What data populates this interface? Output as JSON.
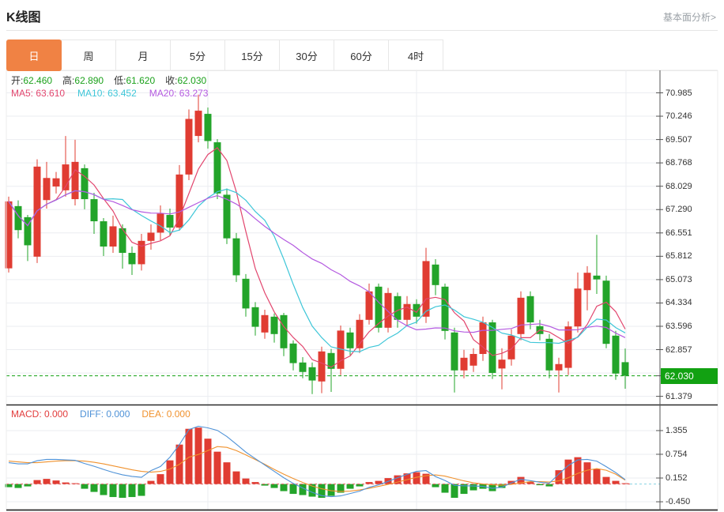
{
  "header": {
    "title": "K线图",
    "link": "基本面分析>"
  },
  "tabs": {
    "active_index": 0,
    "items": [
      "日",
      "周",
      "月",
      "5分",
      "15分",
      "30分",
      "60分",
      "4时"
    ]
  },
  "info_bar": {
    "items": [
      {
        "label": "开:",
        "value": "62.460"
      },
      {
        "label": "高:",
        "value": "62.890"
      },
      {
        "label": "低:",
        "value": "61.620"
      },
      {
        "label": "收:",
        "value": "62.030"
      }
    ],
    "value_color": "#1ba11b"
  },
  "ma_bar": {
    "items": [
      {
        "label": "MA5:",
        "value": "63.610",
        "color": "#e2466e"
      },
      {
        "label": "MA10:",
        "value": "63.452",
        "color": "#3ec6d8"
      },
      {
        "label": "MA20:",
        "value": "63.273",
        "color": "#b45ae0"
      }
    ]
  },
  "macd_bar": {
    "items": [
      {
        "label": "MACD:",
        "value": "0.000",
        "color": "#e23b3b"
      },
      {
        "label": "DIFF:",
        "value": "0.000",
        "color": "#4f92d7"
      },
      {
        "label": "DEA:",
        "value": "0.000",
        "color": "#f0922e"
      }
    ]
  },
  "price_axis": {
    "ticks": [
      {
        "label": "70.985",
        "value": 70.985
      },
      {
        "label": "70.246",
        "value": 70.246
      },
      {
        "label": "69.507",
        "value": 69.507
      },
      {
        "label": "68.768",
        "value": 68.768
      },
      {
        "label": "68.029",
        "value": 68.029
      },
      {
        "label": "67.290",
        "value": 67.29
      },
      {
        "label": "66.551",
        "value": 66.551
      },
      {
        "label": "65.812",
        "value": 65.812
      },
      {
        "label": "65.073",
        "value": 65.073
      },
      {
        "label": "64.334",
        "value": 64.334
      },
      {
        "label": "63.596",
        "value": 63.596
      },
      {
        "label": "62.857",
        "value": 62.857
      },
      {
        "label": "61.379",
        "value": 61.379
      }
    ],
    "current_price_label": "62.030",
    "current_price": 62.03
  },
  "macd_axis": {
    "ticks": [
      {
        "label": "1.355",
        "value": 1.355
      },
      {
        "label": "0.754",
        "value": 0.754
      },
      {
        "label": "0.152",
        "value": 0.152
      },
      {
        "label": "-0.450",
        "value": -0.45
      }
    ]
  },
  "chart_data": {
    "type": "candlestick",
    "title": "K线图",
    "legend": [
      "MA5",
      "MA10",
      "MA20",
      "MACD",
      "DIFF",
      "DEA"
    ],
    "ylim_price": [
      61.2,
      71.0
    ],
    "ylim_macd": [
      -0.75,
      1.66
    ],
    "grid": true,
    "colors": {
      "up": "#e03c32",
      "down": "#23a42a",
      "badge": "#12a112",
      "grid": "#ebedf1",
      "axis": "#555555",
      "dashed_price": "#12a112",
      "dashed_zero": "#e05b5b",
      "dashed_zero_tail": "#86d2e2",
      "diff_line": "#4f92d7",
      "dea_line": "#f0922e"
    },
    "ma_lines": [
      {
        "name": "MA5",
        "period": 5,
        "color": "#e2466e"
      },
      {
        "name": "MA10",
        "period": 10,
        "color": "#3ec6d8"
      },
      {
        "name": "MA20",
        "period": 20,
        "color": "#b45ae0"
      }
    ],
    "last_ohlc": {
      "open": 62.46,
      "high": 62.89,
      "low": 61.62,
      "close": 62.03
    },
    "candles_ohlc": [
      [
        65.43,
        67.7,
        65.3,
        67.55
      ],
      [
        67.4,
        67.58,
        66.38,
        66.64
      ],
      [
        67.05,
        67.12,
        65.66,
        66.16
      ],
      [
        65.8,
        68.88,
        65.6,
        68.65
      ],
      [
        67.59,
        68.8,
        67.32,
        68.29
      ],
      [
        68.02,
        68.48,
        67.8,
        68.28
      ],
      [
        67.9,
        69.62,
        67.7,
        68.72
      ],
      [
        67.62,
        69.5,
        67.42,
        68.8
      ],
      [
        68.6,
        68.72,
        67.3,
        67.62
      ],
      [
        67.62,
        67.82,
        66.52,
        66.92
      ],
      [
        66.92,
        67.02,
        65.82,
        66.12
      ],
      [
        66.12,
        67.1,
        65.92,
        66.76
      ],
      [
        66.7,
        66.82,
        65.42,
        65.92
      ],
      [
        65.92,
        66.12,
        65.22,
        65.56
      ],
      [
        65.56,
        66.52,
        65.36,
        66.3
      ],
      [
        66.3,
        66.82,
        66.02,
        66.56
      ],
      [
        66.56,
        67.42,
        66.32,
        67.16
      ],
      [
        67.12,
        67.32,
        66.48,
        66.72
      ],
      [
        66.72,
        68.7,
        66.62,
        68.4
      ],
      [
        68.4,
        70.46,
        68.22,
        70.16
      ],
      [
        69.62,
        70.93,
        69.42,
        70.42
      ],
      [
        70.32,
        70.52,
        69.22,
        69.46
      ],
      [
        69.42,
        69.52,
        67.62,
        67.8
      ],
      [
        67.76,
        67.96,
        66.2,
        66.38
      ],
      [
        66.38,
        66.55,
        65.0,
        65.21
      ],
      [
        65.1,
        65.25,
        63.9,
        64.16
      ],
      [
        64.2,
        64.36,
        63.3,
        63.58
      ],
      [
        63.4,
        64.12,
        63.2,
        63.95
      ],
      [
        63.9,
        64.0,
        63.08,
        63.35
      ],
      [
        63.95,
        64.02,
        62.65,
        62.9
      ],
      [
        63.05,
        63.15,
        62.2,
        62.43
      ],
      [
        62.45,
        62.62,
        61.95,
        62.15
      ],
      [
        62.3,
        62.45,
        61.45,
        61.88
      ],
      [
        61.85,
        62.95,
        61.48,
        62.8
      ],
      [
        62.75,
        62.88,
        61.52,
        62.25
      ],
      [
        62.25,
        63.62,
        62.05,
        63.46
      ],
      [
        63.4,
        63.55,
        62.68,
        62.9
      ],
      [
        62.9,
        63.98,
        62.75,
        63.8
      ],
      [
        63.8,
        64.95,
        63.65,
        64.7
      ],
      [
        64.85,
        64.95,
        63.4,
        63.55
      ],
      [
        63.55,
        64.81,
        63.4,
        64.65
      ],
      [
        64.55,
        64.66,
        63.55,
        63.8
      ],
      [
        63.8,
        64.55,
        63.6,
        64.3
      ],
      [
        64.3,
        64.45,
        63.68,
        63.9
      ],
      [
        63.9,
        66.08,
        63.7,
        65.66
      ],
      [
        65.55,
        65.72,
        64.58,
        64.9
      ],
      [
        64.85,
        64.95,
        63.18,
        63.45
      ],
      [
        63.4,
        63.55,
        61.5,
        62.2
      ],
      [
        62.2,
        62.85,
        61.95,
        62.6
      ],
      [
        62.35,
        62.9,
        62.15,
        62.72
      ],
      [
        62.72,
        63.9,
        62.5,
        63.72
      ],
      [
        63.72,
        63.8,
        61.93,
        62.12
      ],
      [
        62.26,
        62.9,
        61.6,
        62.54
      ],
      [
        62.55,
        63.5,
        62.35,
        63.3
      ],
      [
        63.35,
        64.7,
        63.15,
        64.5
      ],
      [
        64.55,
        64.7,
        63.5,
        63.72
      ],
      [
        63.6,
        63.8,
        63.15,
        63.35
      ],
      [
        63.2,
        63.35,
        61.95,
        62.2
      ],
      [
        62.2,
        62.6,
        61.5,
        62.4
      ],
      [
        62.28,
        63.75,
        62.05,
        63.59
      ],
      [
        63.59,
        65.3,
        63.4,
        64.79
      ],
      [
        64.74,
        65.5,
        64.1,
        65.29
      ],
      [
        65.2,
        66.49,
        64.62,
        65.08
      ],
      [
        65.04,
        65.2,
        62.9,
        63.04
      ],
      [
        63.3,
        63.45,
        61.9,
        62.1
      ],
      [
        62.46,
        62.89,
        61.62,
        62.03
      ]
    ],
    "macd": {
      "note": "hist bars (red>=0, green<0); diff = dea + hist/2",
      "hist": [
        -0.08,
        -0.1,
        -0.06,
        0.1,
        0.13,
        0.09,
        0.04,
        0.02,
        -0.12,
        -0.2,
        -0.28,
        -0.33,
        -0.35,
        -0.33,
        -0.3,
        0.08,
        0.25,
        0.6,
        1.0,
        1.4,
        1.43,
        1.15,
        0.82,
        0.55,
        0.32,
        0.14,
        0.05,
        -0.04,
        -0.1,
        -0.18,
        -0.25,
        -0.28,
        -0.32,
        -0.35,
        -0.3,
        -0.22,
        -0.12,
        -0.06,
        0.05,
        0.08,
        0.15,
        0.22,
        0.27,
        0.3,
        0.26,
        -0.08,
        -0.22,
        -0.35,
        -0.25,
        -0.16,
        -0.12,
        -0.18,
        -0.1,
        0.08,
        0.18,
        0.05,
        -0.03,
        -0.06,
        0.35,
        0.62,
        0.68,
        0.55,
        0.38,
        0.18,
        0.08,
        0.02
      ],
      "dea": [
        0.58,
        0.56,
        0.54,
        0.54,
        0.56,
        0.58,
        0.59,
        0.59,
        0.58,
        0.55,
        0.51,
        0.46,
        0.41,
        0.36,
        0.32,
        0.3,
        0.32,
        0.38,
        0.5,
        0.68,
        0.75,
        0.85,
        0.95,
        0.93,
        0.85,
        0.74,
        0.62,
        0.5,
        0.37,
        0.25,
        0.14,
        0.04,
        -0.05,
        -0.12,
        -0.17,
        -0.19,
        -0.18,
        -0.15,
        -0.11,
        -0.06,
        -0.01,
        0.05,
        0.11,
        0.17,
        0.21,
        0.23,
        0.2,
        0.14,
        0.08,
        0.03,
        0.0,
        -0.02,
        -0.03,
        -0.01,
        0.03,
        0.06,
        0.06,
        0.05,
        0.08,
        0.16,
        0.27,
        0.35,
        0.39,
        0.35,
        0.25,
        0.1
      ]
    }
  }
}
